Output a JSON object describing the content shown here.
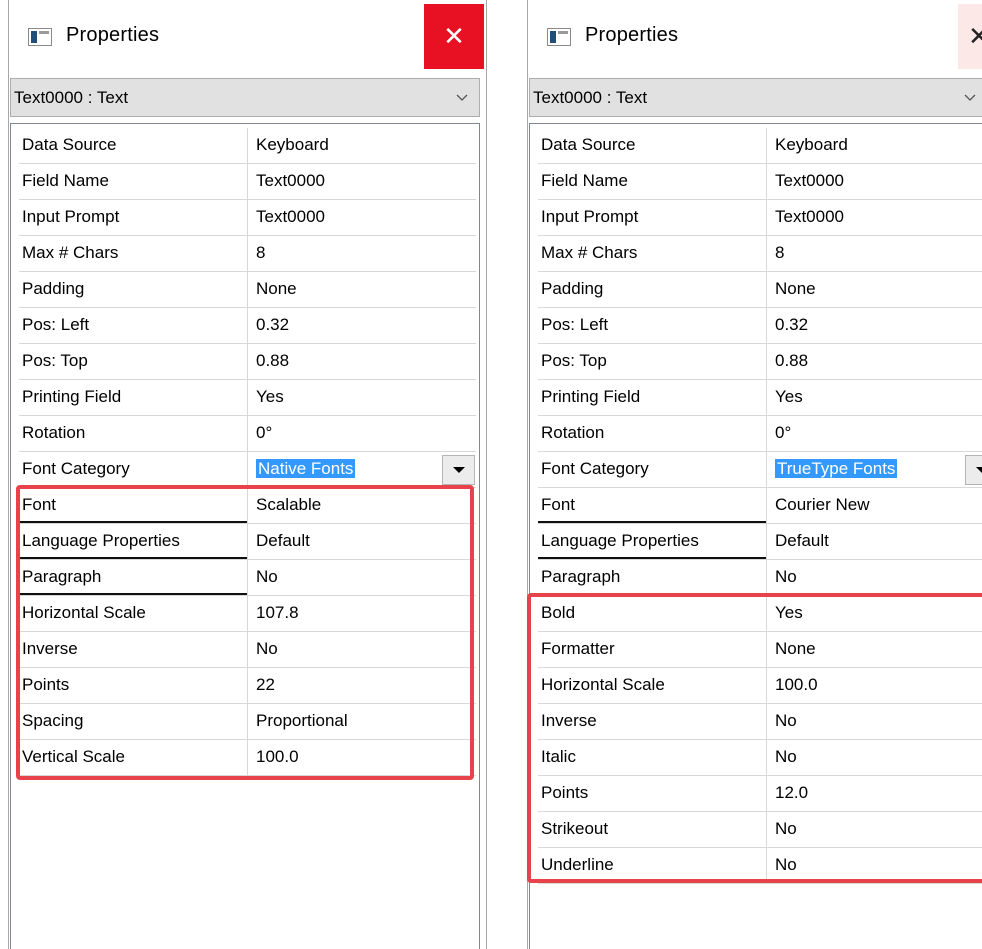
{
  "left_panel": {
    "title": "Properties",
    "close_symbol": "✕",
    "object_selector": "Text0000 : Text",
    "properties": [
      {
        "name": "Data Source",
        "value": "Keyboard"
      },
      {
        "name": "Field Name",
        "value": "Text0000"
      },
      {
        "name": "Input Prompt",
        "value": "Text0000"
      },
      {
        "name": "Max # Chars",
        "value": "8"
      },
      {
        "name": "Padding",
        "value": "None"
      },
      {
        "name": "Pos: Left",
        "value": "0.32"
      },
      {
        "name": "Pos: Top",
        "value": "0.88"
      },
      {
        "name": "Printing Field",
        "value": "Yes"
      },
      {
        "name": "Rotation",
        "value": "0°"
      },
      {
        "name": "Font Category",
        "value": "Native Fonts"
      },
      {
        "name": "Font",
        "value": "Scalable"
      },
      {
        "name": "Language Properties",
        "value": "Default"
      },
      {
        "name": "Paragraph",
        "value": "No"
      },
      {
        "name": "Horizontal Scale",
        "value": "107.8"
      },
      {
        "name": "Inverse",
        "value": "No"
      },
      {
        "name": "Points",
        "value": "22"
      },
      {
        "name": "Spacing",
        "value": "Proportional"
      },
      {
        "name": "Vertical Scale",
        "value": "100.0"
      }
    ]
  },
  "right_panel": {
    "title": "Properties",
    "close_symbol": "✕",
    "object_selector": "Text0000 : Text",
    "properties": [
      {
        "name": "Data Source",
        "value": "Keyboard"
      },
      {
        "name": "Field Name",
        "value": "Text0000"
      },
      {
        "name": "Input Prompt",
        "value": "Text0000"
      },
      {
        "name": "Max # Chars",
        "value": "8"
      },
      {
        "name": "Padding",
        "value": "None"
      },
      {
        "name": "Pos: Left",
        "value": "0.32"
      },
      {
        "name": "Pos: Top",
        "value": "0.88"
      },
      {
        "name": "Printing Field",
        "value": "Yes"
      },
      {
        "name": "Rotation",
        "value": "0°"
      },
      {
        "name": "Font Category",
        "value": "TrueType Fonts"
      },
      {
        "name": "Font",
        "value": "Courier New"
      },
      {
        "name": "Language Properties",
        "value": "Default"
      },
      {
        "name": "Paragraph",
        "value": "No"
      },
      {
        "name": "Bold",
        "value": "Yes"
      },
      {
        "name": "Formatter",
        "value": "None"
      },
      {
        "name": "Horizontal Scale",
        "value": "100.0"
      },
      {
        "name": "Inverse",
        "value": "No"
      },
      {
        "name": "Italic",
        "value": "No"
      },
      {
        "name": "Points",
        "value": "12.0"
      },
      {
        "name": "Strikeout",
        "value": "No"
      },
      {
        "name": "Underline",
        "value": "No"
      }
    ]
  },
  "colors": {
    "close_button_bg": "#e81123",
    "selection_highlight": "#3399ff",
    "annotation_box": "#e8434a"
  },
  "icons": [
    "properties-window-icon",
    "close-icon",
    "chevron-down-icon",
    "dropdown-arrow-icon"
  ]
}
